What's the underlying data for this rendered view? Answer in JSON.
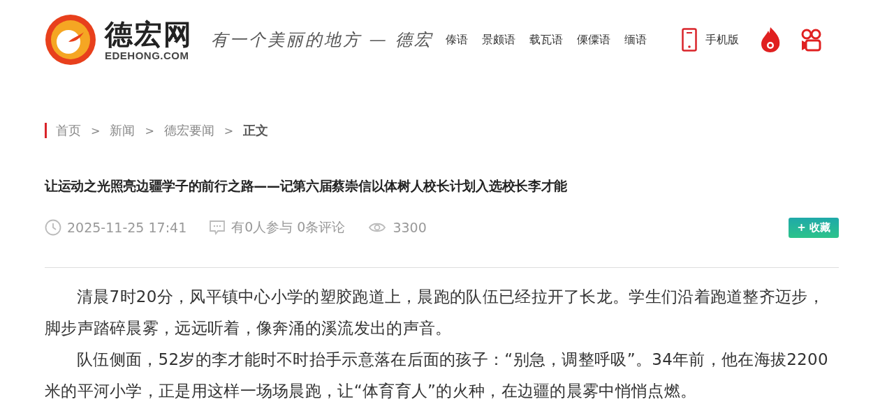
{
  "header": {
    "logo_title": "德宏网",
    "logo_domain": "EDEHONG.COM",
    "slogan": "有一个美丽的地方 — 德宏",
    "languages": [
      {
        "label": "傣语"
      },
      {
        "label": "景颇语"
      },
      {
        "label": "载瓦语"
      },
      {
        "label": "傈僳语"
      },
      {
        "label": "缅语"
      }
    ],
    "mobile": "手机版"
  },
  "breadcrumb": [
    {
      "label": "首页",
      "selected": false
    },
    {
      "label": "新闻",
      "selected": false
    },
    {
      "label": "德宏要闻",
      "selected": false
    },
    {
      "label": "正文",
      "selected": true
    }
  ],
  "breadcrumb_separator": ">",
  "article": {
    "title": "让运动之光照亮边疆学子的前行之路——记第六届蔡崇信以体树人校长计划入选校长李才能",
    "date": "2025-11-25 17:41",
    "comments": "有0人参与 0条评论",
    "views": "3300",
    "favorite_button": "+ 收藏",
    "paragraphs": [
      "清晨7时20分，风平镇中心小学的塑胶跑道上，晨跑的队伍已经拉开了长龙。学生们沿着跑道整齐迈步，脚步声踏碎晨雾，远远听着，像奔涌的溪流发出的声音。",
      "队伍侧面，52岁的李才能时不时抬手示意落在后面的孩子：“别急，调整呼吸”。34年前，他在海拔2200米的平河小学，正是用这样一场场晨跑，让“体育育人”的火种，在边疆的晨雾中悄悄点燃。"
    ]
  }
}
